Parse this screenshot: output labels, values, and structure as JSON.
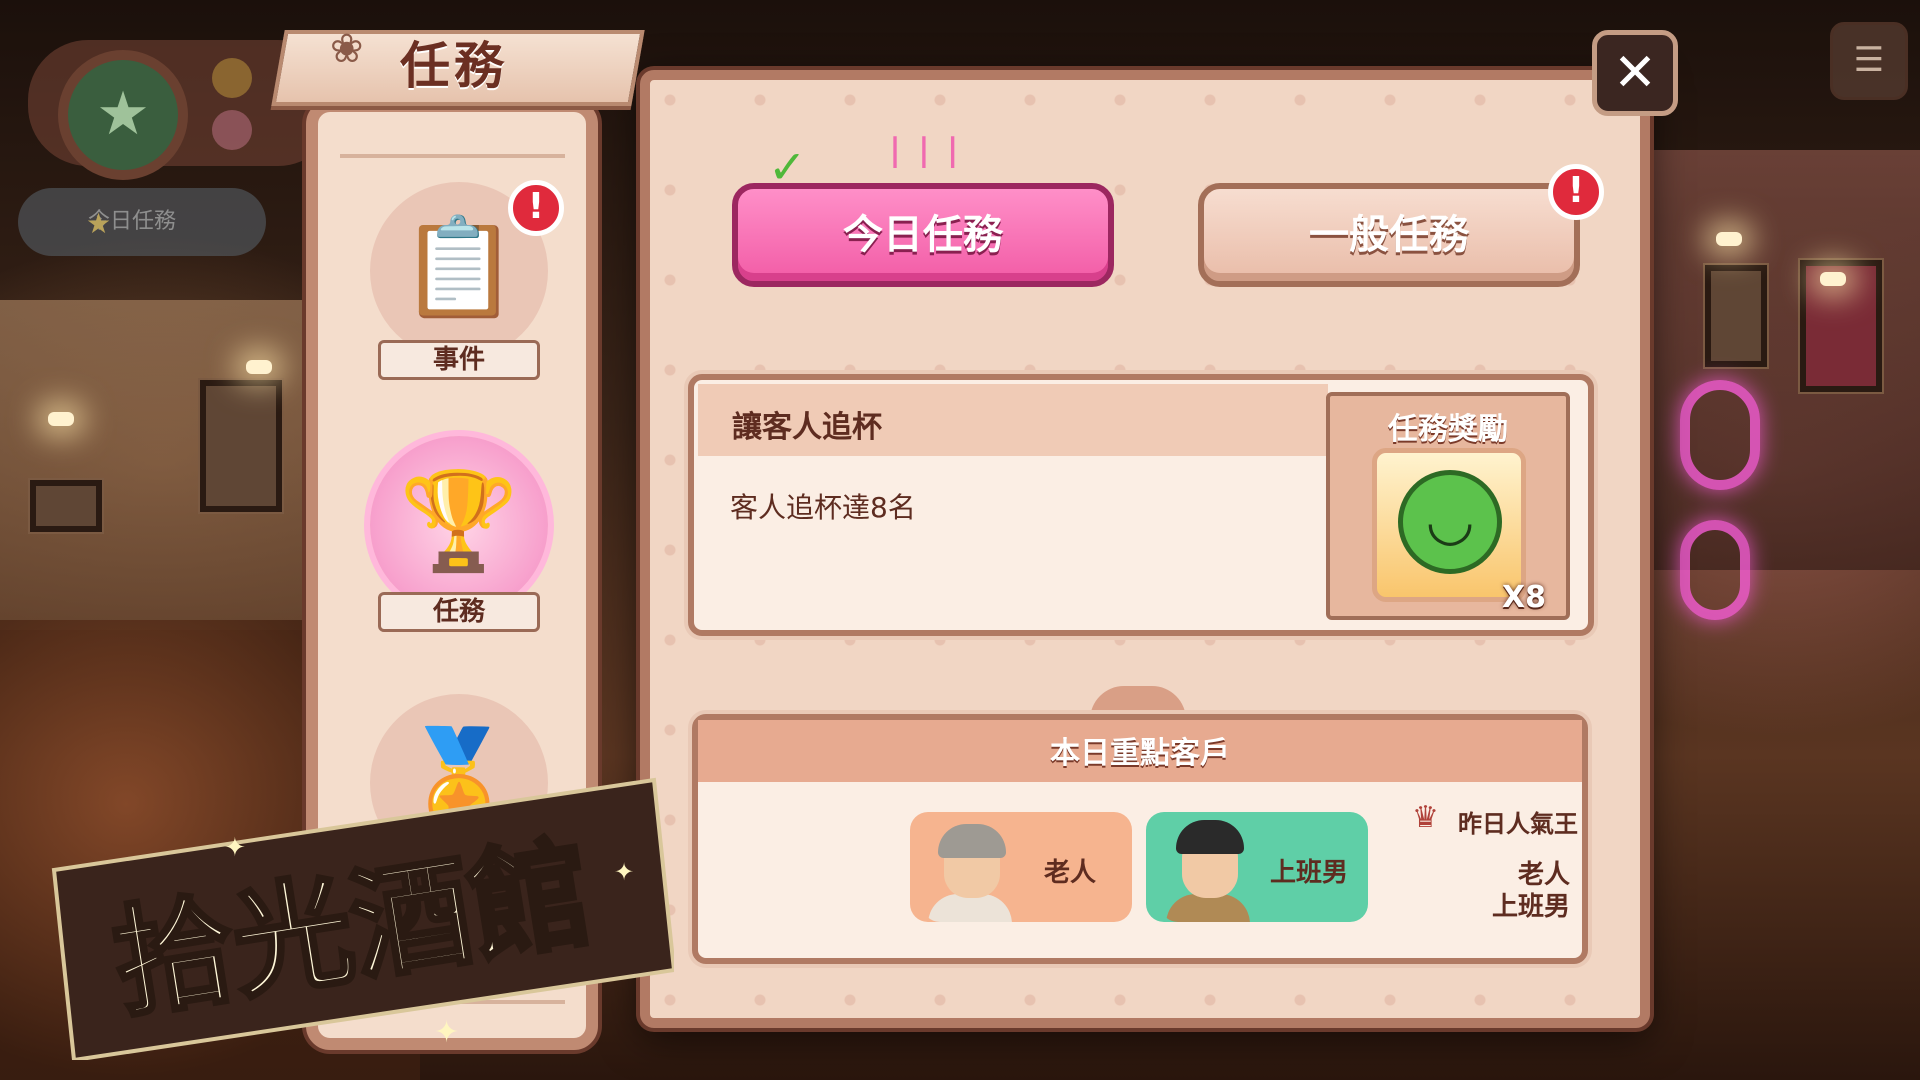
{
  "window": {
    "title": "任務",
    "close_symbol": "✕",
    "menu_symbol": "☰"
  },
  "hud": {
    "star_symbol": "★",
    "daily_task_label": "今日任務"
  },
  "sidebar": {
    "items": [
      {
        "label": "事件",
        "icon": "event-book-icon",
        "glyph": "📋",
        "alert": "!"
      },
      {
        "label": "任務",
        "icon": "trophy-icon",
        "glyph": "🏆",
        "alert": ""
      },
      {
        "label": "",
        "icon": "medal-icon",
        "glyph": "🏅",
        "alert": ""
      }
    ]
  },
  "tabs": [
    {
      "label": "今日任務",
      "selected": true
    },
    {
      "label": "一般任務",
      "selected": false,
      "alert": "!"
    }
  ],
  "mission": {
    "title": "讓客人追杯",
    "description": "客人追杯達8名",
    "reward_title": "任務獎勵",
    "reward_icon": "smiley-icon",
    "reward_glyph": "◡",
    "reward_qty": "X8"
  },
  "customers": {
    "title": "本日重點客戶",
    "list": [
      {
        "name": "老人",
        "color": "#f6b48f"
      },
      {
        "name": "上班男",
        "color": "#5fcfa7"
      }
    ],
    "popular_title": "昨日人氣王",
    "popular": [
      "老人",
      "上班男"
    ]
  },
  "logo_text": "拾光酒館",
  "colors": {
    "accent_pink": "#f25ca6",
    "alert_red": "#e02a3c",
    "panel_bg": "#f1d6c4"
  }
}
